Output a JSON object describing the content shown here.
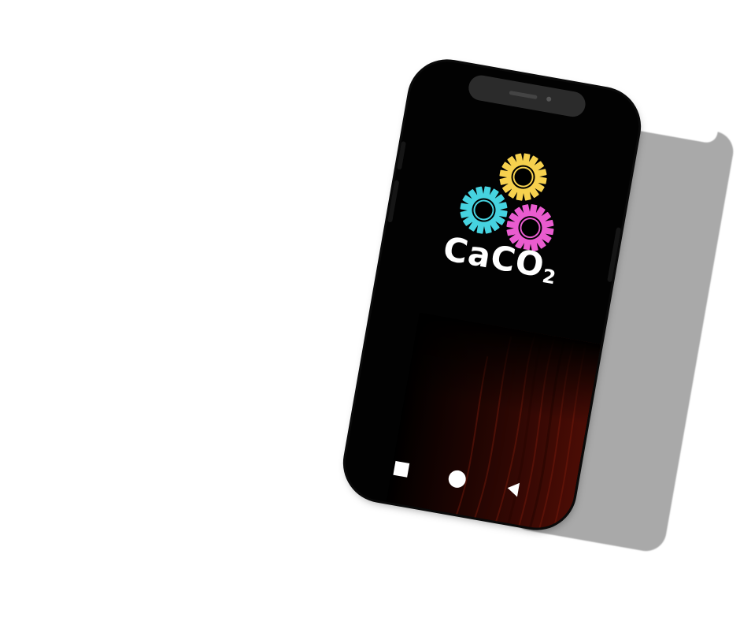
{
  "app": {
    "logo_text": "CaCO",
    "logo_subscript": "2"
  },
  "logo": {
    "gears": [
      {
        "name": "yellow-gear",
        "color": "#f6d14e"
      },
      {
        "name": "cyan-gear",
        "color": "#46d3e0"
      },
      {
        "name": "magenta-gear",
        "color": "#e95ccf"
      }
    ]
  },
  "navigation": {
    "items": [
      {
        "name": "recents",
        "icon": "square-icon"
      },
      {
        "name": "home",
        "icon": "circle-icon"
      },
      {
        "name": "back",
        "icon": "triangle-back-icon"
      }
    ]
  },
  "colors": {
    "screen_background": "#000000",
    "wood_accent": "#4a0c05",
    "shadow_panel": "#a9a9a9"
  }
}
